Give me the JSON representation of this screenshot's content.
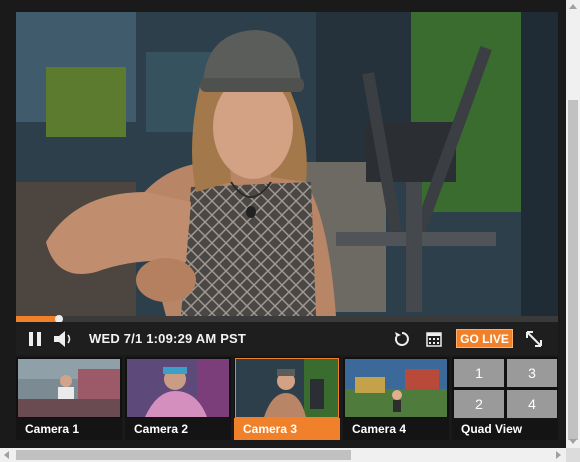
{
  "player": {
    "timestamp": "WED 7/1 1:09:29 AM PST",
    "go_live_label": "GO LIVE",
    "progress_fraction": 0.08
  },
  "icons": {
    "pause": "pause-icon",
    "volume": "volume-icon",
    "replay": "replay-icon",
    "calendar": "calendar-icon",
    "fullscreen": "fullscreen-icon"
  },
  "cameras": [
    {
      "label": "Camera 1"
    },
    {
      "label": "Camera 2"
    },
    {
      "label": "Camera 3",
      "active": true
    },
    {
      "label": "Camera 4"
    }
  ],
  "quad": {
    "label": "Quad View",
    "cells": [
      "1",
      "3",
      "2",
      "4"
    ]
  },
  "colors": {
    "accent": "#f0812a",
    "player_bg": "#1a1a1a"
  }
}
